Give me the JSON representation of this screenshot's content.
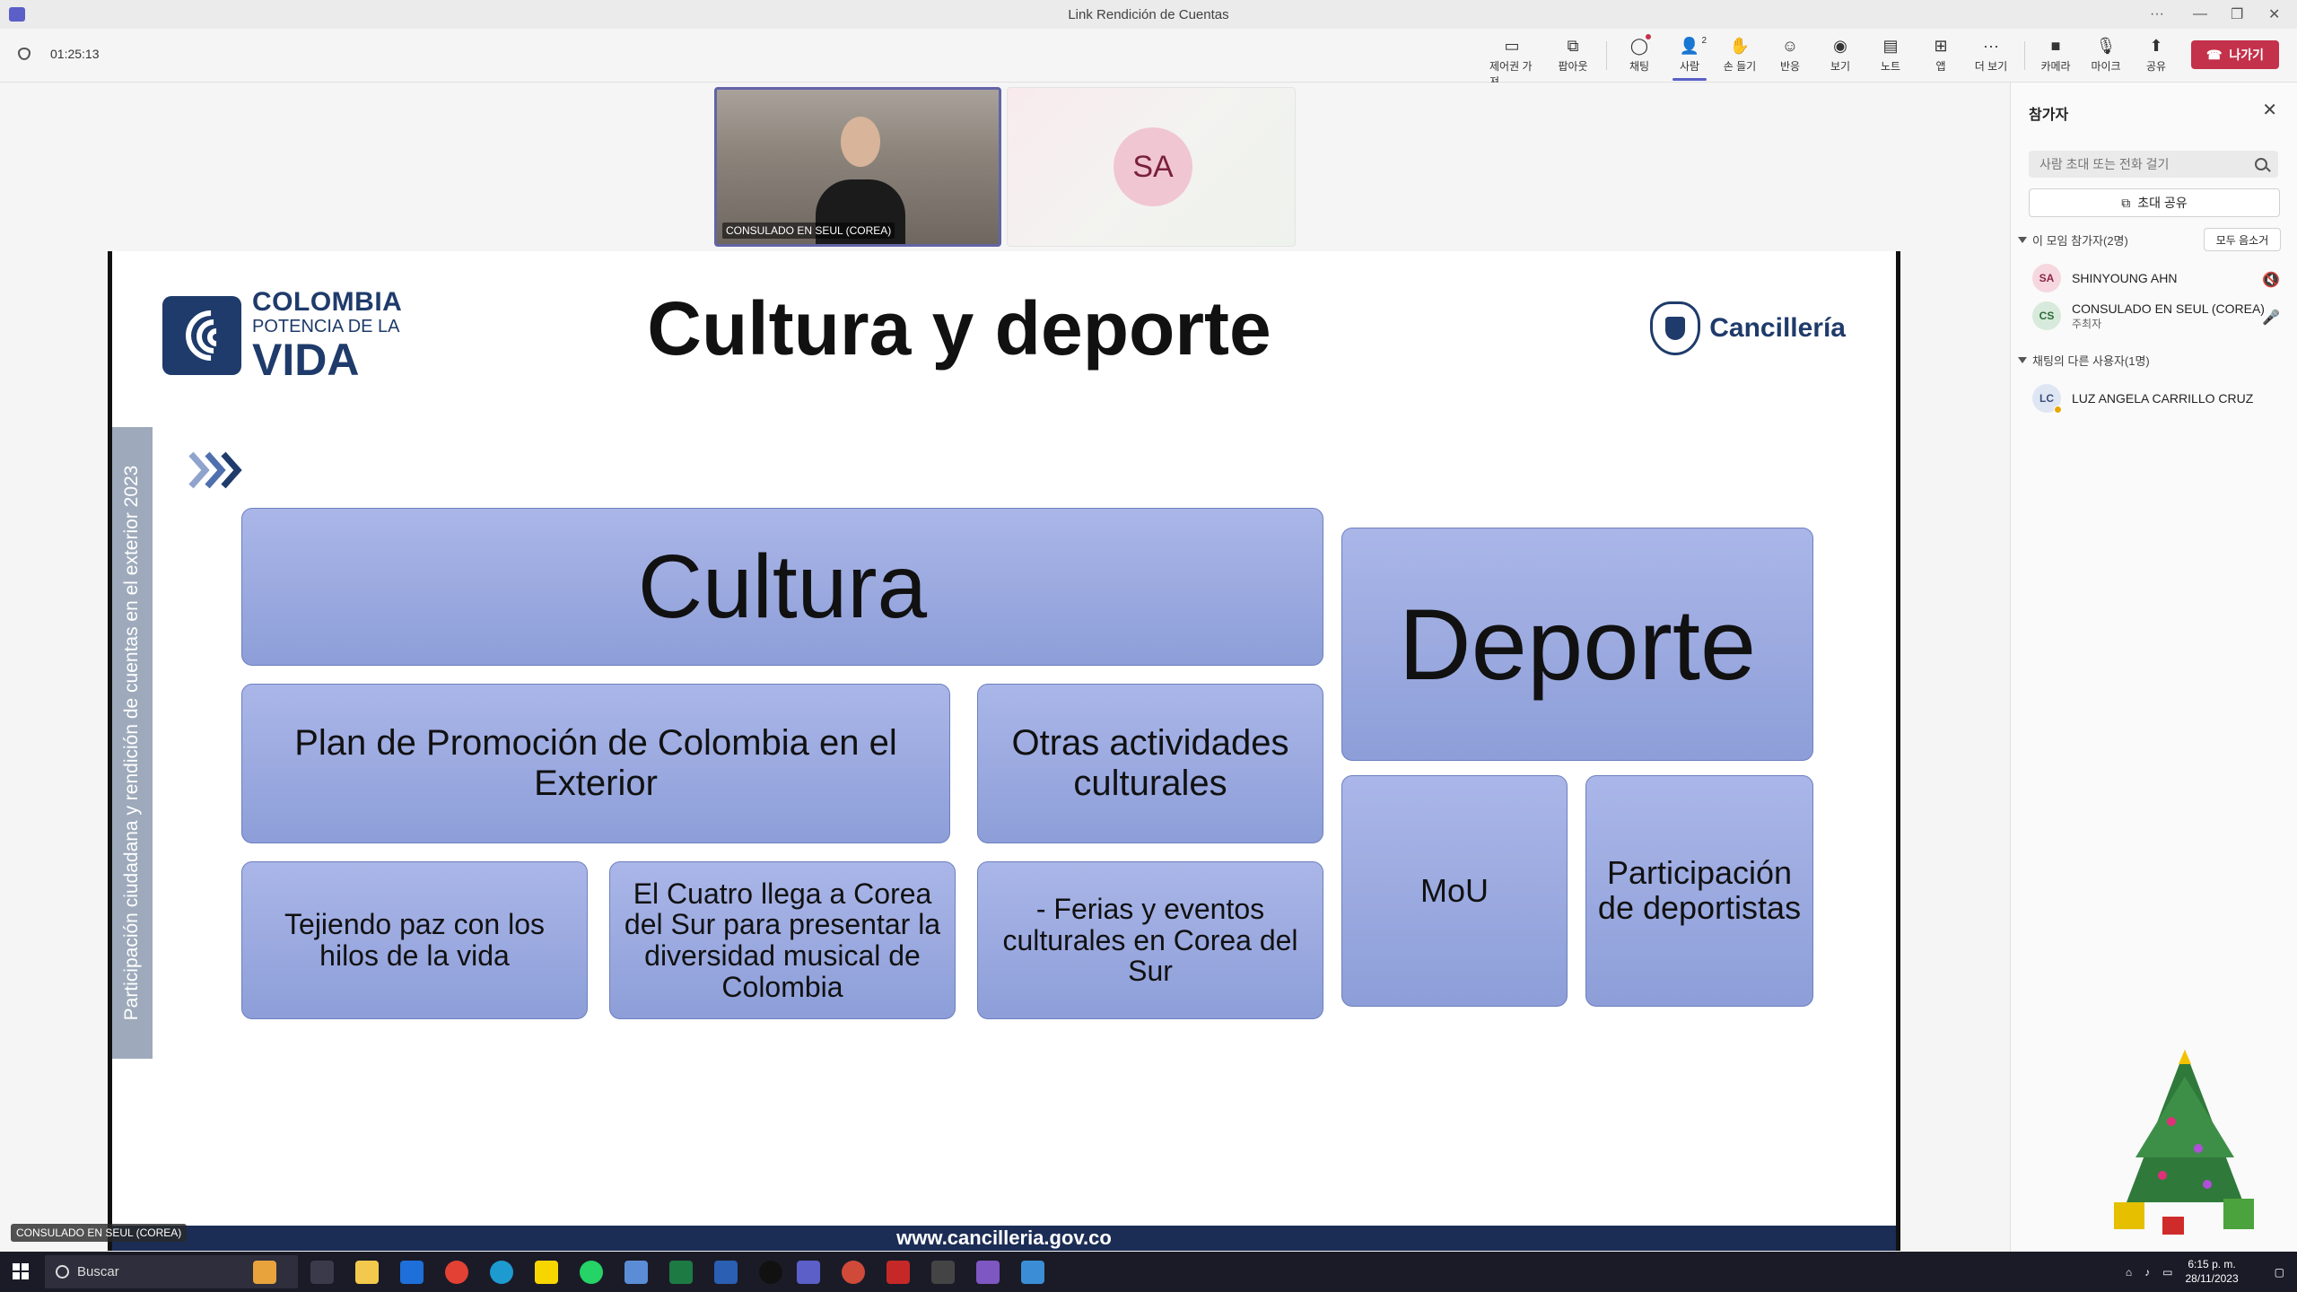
{
  "window": {
    "title": "Link Rendición de Cuentas"
  },
  "toolbar": {
    "timer": "01:25:13",
    "buttons": [
      {
        "label": "제어권 가져...",
        "icon": "take-control-icon"
      },
      {
        "label": "팝아웃",
        "icon": "popout-icon"
      },
      {
        "label": "채팅",
        "icon": "chat-icon"
      },
      {
        "label": "사람",
        "icon": "people-icon",
        "badge": "2"
      },
      {
        "label": "손 들기",
        "icon": "raise-hand-icon"
      },
      {
        "label": "반응",
        "icon": "reactions-icon"
      },
      {
        "label": "보기",
        "icon": "view-icon"
      },
      {
        "label": "노트",
        "icon": "notes-icon"
      },
      {
        "label": "앱",
        "icon": "apps-icon"
      },
      {
        "label": "더 보기",
        "icon": "more-icon"
      },
      {
        "label": "카메라",
        "icon": "camera-icon"
      },
      {
        "label": "마이크",
        "icon": "mic-off-icon"
      },
      {
        "label": "공유",
        "icon": "share-icon"
      }
    ],
    "leave_label": "나가기"
  },
  "stage": {
    "video_main_label": "CONSULADO EN SEUL (COREA)",
    "video_sa_initials": "SA",
    "speaker_tag": "CONSULADO EN SEUL (COREA)"
  },
  "slide": {
    "title": "Cultura y deporte",
    "logo": {
      "line1": "COLOMBIA",
      "line2": "POTENCIA DE LA",
      "line3": "VIDA"
    },
    "cancilleria": "Cancillería",
    "side_text": "Participación ciudadana y rendición de cuentas en el exterior 2023",
    "boxes": {
      "cultura": "Cultura",
      "deporte": "Deporte",
      "plan": "Plan de Promoción de Colombia en el Exterior",
      "otras": "Otras actividades culturales",
      "tejiendo": "Tejiendo paz con los hilos de la vida",
      "cuatro": "El Cuatro llega a Corea del Sur para presentar la diversidad musical de Colombia",
      "ferias": "- Ferias y eventos culturales en Corea del Sur",
      "mou": "MoU",
      "participacion": "Participación de deportistas"
    },
    "footer": "www.cancilleria.gov.co"
  },
  "panel": {
    "title": "참가자",
    "invite_placeholder": "사람 초대 또는 전화 걸기",
    "share_invite": "초대 공유",
    "section_meeting": "이 모임 참가자(2명)",
    "mute_all": "모두 음소거",
    "participants": [
      {
        "initials": "SA",
        "name": "SHINYOUNG AHN",
        "role": "",
        "mic": "muted"
      },
      {
        "initials": "CS",
        "name": "CONSULADO EN SEUL (COREA)",
        "role": "주최자",
        "mic": "on"
      }
    ],
    "section_chat": "채팅의 다른 사용자(1명)",
    "chat_users": [
      {
        "initials": "LC",
        "name": "LUZ ANGELA CARRILLO CRUZ"
      }
    ]
  },
  "taskbar": {
    "search_label": "Buscar",
    "time": "6:15 p. m.",
    "date": "28/11/2023"
  },
  "colors": {
    "teams_purple": "#5b5fc7",
    "leave_red": "#c4314b",
    "slide_navy": "#1f3b6b",
    "box_blue": "#8d9ed8"
  }
}
